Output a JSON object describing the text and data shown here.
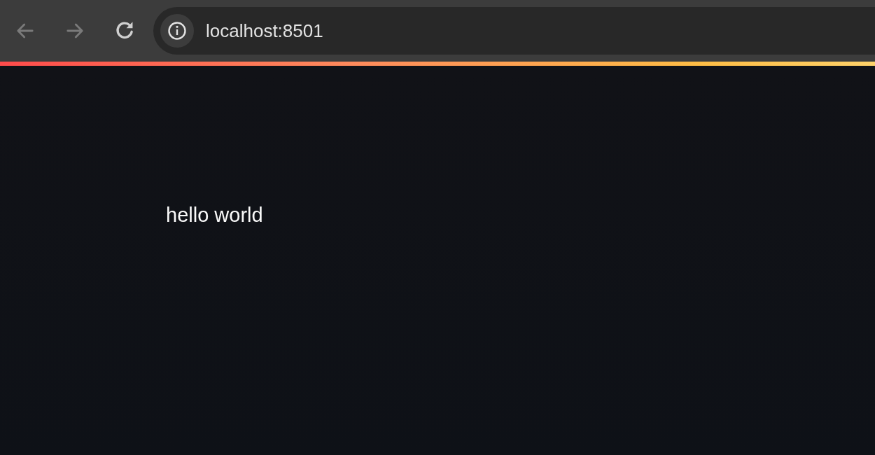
{
  "browser_toolbar": {
    "nav_buttons": [
      {
        "kind": "back",
        "disabled": true
      },
      {
        "kind": "forward",
        "disabled": true
      },
      {
        "kind": "reload",
        "disabled": false
      }
    ],
    "address_bar": {
      "url": "localhost:8501"
    }
  },
  "content": {
    "text": "hello world"
  }
}
